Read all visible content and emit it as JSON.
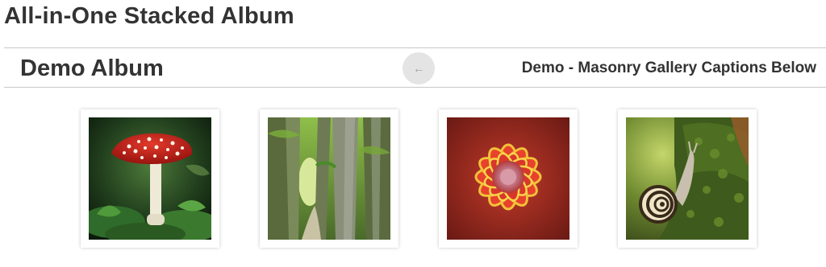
{
  "page": {
    "title": "All-in-One Stacked Album"
  },
  "album": {
    "title": "Demo Album",
    "back_icon": "←",
    "gallery_title": "Demo - Masonry Gallery Captions Below"
  },
  "thumbnails": [
    {
      "subject": "red-mushroom-image"
    },
    {
      "subject": "forest-path-image"
    },
    {
      "subject": "red-dahlia-image"
    },
    {
      "subject": "snail-on-moss-image"
    }
  ]
}
